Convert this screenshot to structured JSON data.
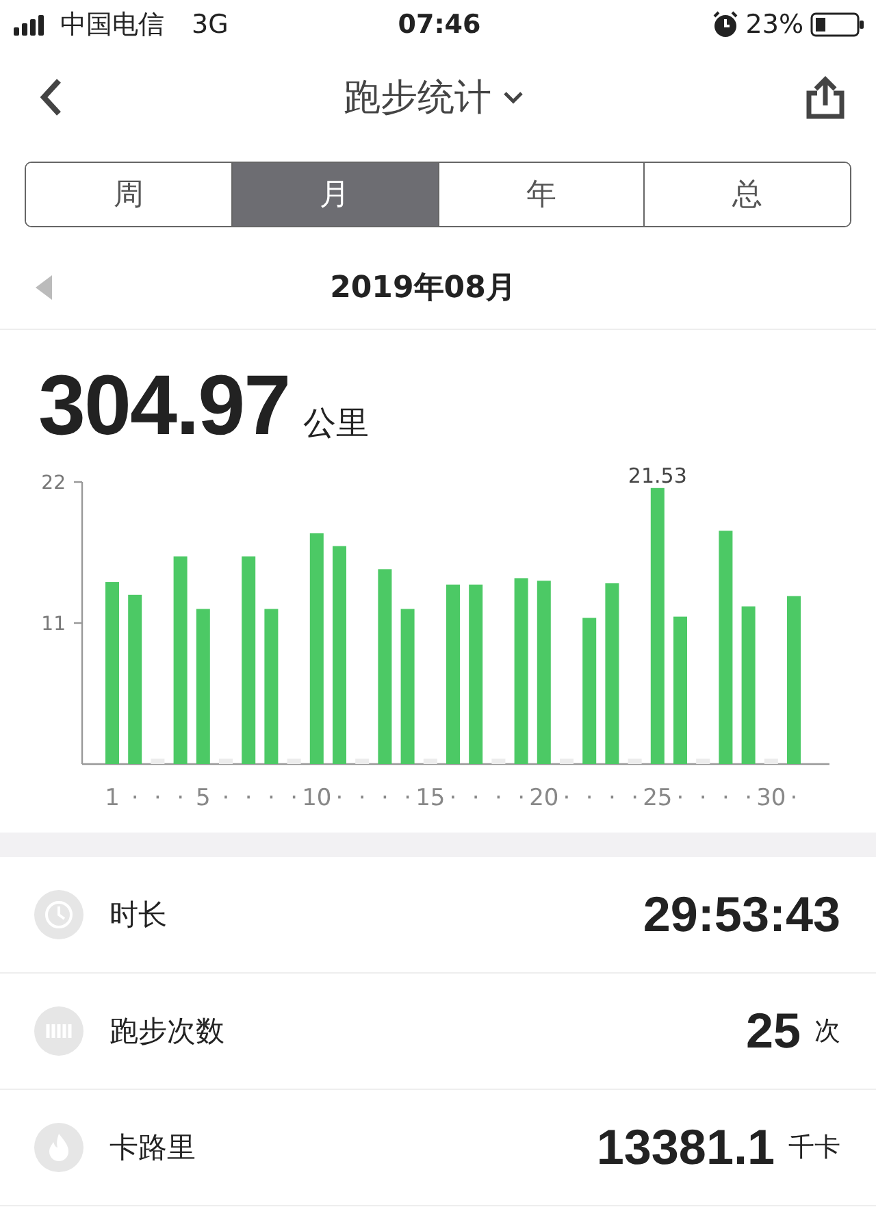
{
  "status_bar": {
    "carrier": "中国电信",
    "network": "3G",
    "time": "07:46",
    "battery": "23%"
  },
  "header": {
    "title": "跑步统计"
  },
  "tabs": [
    {
      "label": "周",
      "selected": false
    },
    {
      "label": "月",
      "selected": true
    },
    {
      "label": "年",
      "selected": false
    },
    {
      "label": "总",
      "selected": false
    }
  ],
  "period": {
    "label": "2019年08月"
  },
  "total": {
    "value": "304.97",
    "unit": "公里"
  },
  "chart": {
    "chart_data": {
      "type": "bar",
      "ylim": [
        0,
        22
      ],
      "yticks": [
        11,
        22
      ],
      "categories": [
        "1",
        "·",
        "·",
        "·",
        "5",
        "·",
        "·",
        "·",
        "·",
        "10",
        "·",
        "·",
        "·",
        "·",
        "15",
        "·",
        "·",
        "·",
        "·",
        "20",
        "·",
        "·",
        "·",
        "·",
        "25",
        "·",
        "·",
        "·",
        "·",
        "30",
        "·"
      ],
      "series": [
        {
          "color": "#4cc965",
          "values": [
            14.2,
            13.2,
            0,
            16.2,
            12.1,
            0,
            16.2,
            12.1,
            0,
            18.0,
            17.0,
            0,
            15.2,
            12.1,
            0,
            14.0,
            14.0,
            0,
            14.5,
            14.3,
            0,
            11.4,
            14.1,
            0,
            21.53,
            11.5,
            0,
            18.2,
            12.3,
            0,
            13.1
          ]
        }
      ],
      "annotations": [
        "21.53"
      ]
    }
  },
  "stats": [
    {
      "kind": "duration",
      "label": "时长",
      "value": "29:53:43"
    },
    {
      "kind": "runs",
      "label": "跑步次数",
      "value": "25",
      "unit": "次"
    },
    {
      "kind": "calories",
      "label": "卡路里",
      "value": "13381.1",
      "unit": "千卡"
    }
  ]
}
